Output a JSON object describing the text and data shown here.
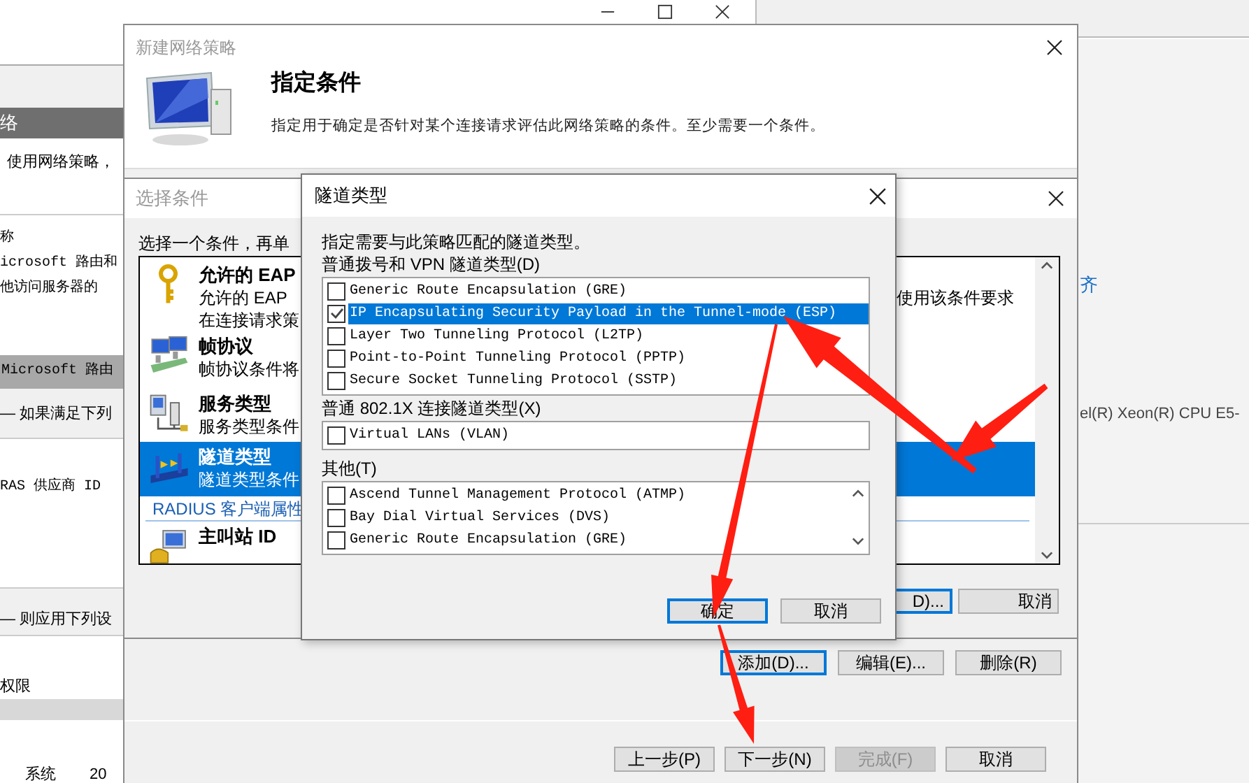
{
  "background_window": {
    "section_header": "络",
    "intro": "使用网络策略，",
    "detail_lines": [
      "称",
      "icrosoft 路由和",
      "他访问服务器的"
    ],
    "policy_bar": "Microsoft 路由",
    "conditions_heading": "— 如果满足下列",
    "conditions_column": "RAS 供应商 ID",
    "settings_heading": "— 则应用下列设",
    "settings_item": "权限",
    "bottom_row": [
      "系统",
      "20"
    ],
    "side_link": "齐",
    "side_info": "el(R) Xeon(R) CPU E5-"
  },
  "new_policy_dialog": {
    "title": "新建网络策略",
    "heading": "指定条件",
    "description": "指定用于确定是否针对某个连接请求评估此网络策略的条件。至少需要一个条件。",
    "condition_buttons": [
      {
        "label": "添加(D)...",
        "default": true
      },
      {
        "label": "编辑(E)...",
        "default": false
      },
      {
        "label": "删除(R)",
        "default": false
      }
    ],
    "nav_buttons": [
      {
        "label": "上一步(P)",
        "disabled": false
      },
      {
        "label": "下一步(N)",
        "disabled": false
      },
      {
        "label": "完成(F)",
        "disabled": true
      },
      {
        "label": "取消",
        "disabled": false
      }
    ]
  },
  "select_condition_dialog": {
    "title": "选择条件",
    "instruction": "选择一个条件，再单",
    "conditions": [
      {
        "kind": "condition",
        "title": "允许的 EAP",
        "description_lines": [
          "允许的 EAP",
          "在连接请求策"
        ],
        "description_tail": "使用该条件要求",
        "selected": false
      },
      {
        "kind": "condition",
        "title": "帧协议",
        "description_lines": [
          "帧协议条件将"
        ],
        "selected": false
      },
      {
        "kind": "condition",
        "title": "服务类型",
        "description_lines": [
          "服务类型条件"
        ],
        "selected": false
      },
      {
        "kind": "condition",
        "title": "隧道类型",
        "description_lines": [
          "隧道类型条件"
        ],
        "selected": true
      },
      {
        "kind": "group",
        "title": "RADIUS 客户端属性",
        "selected": false
      },
      {
        "kind": "condition",
        "title": "主叫站 ID",
        "selected": false
      }
    ],
    "buttons": [
      {
        "label": "D)...",
        "default": true
      },
      {
        "label": "取消",
        "default": false
      }
    ]
  },
  "tunnel_type_dialog": {
    "title": "隧道类型",
    "instruction": "指定需要与此策略匹配的隧道类型。",
    "groups": [
      {
        "label": "普通拨号和 VPN 隧道类型(D)",
        "scrollable": false,
        "items": [
          {
            "label": "Generic Route Encapsulation (GRE)",
            "checked": false,
            "selected": false
          },
          {
            "label": "IP Encapsulating Security Payload in the Tunnel-mode (ESP)",
            "checked": true,
            "selected": true
          },
          {
            "label": "Layer Two Tunneling Protocol (L2TP)",
            "checked": false,
            "selected": false
          },
          {
            "label": "Point-to-Point Tunneling Protocol (PPTP)",
            "checked": false,
            "selected": false
          },
          {
            "label": "Secure Socket Tunneling Protocol (SSTP)",
            "checked": false,
            "selected": false
          }
        ]
      },
      {
        "label": "普通 802.1X 连接隧道类型(X)",
        "scrollable": false,
        "items": [
          {
            "label": "Virtual LANs (VLAN)",
            "checked": false,
            "selected": false
          }
        ]
      },
      {
        "label": "其他(T)",
        "scrollable": true,
        "items": [
          {
            "label": "Ascend Tunnel Management Protocol (ATMP)",
            "checked": false,
            "selected": false
          },
          {
            "label": "Bay Dial Virtual Services (DVS)",
            "checked": false,
            "selected": false
          },
          {
            "label": "Generic Route Encapsulation (GRE)",
            "checked": false,
            "selected": false
          }
        ]
      }
    ],
    "buttons": [
      {
        "label": "确定",
        "default": true
      },
      {
        "label": "取消",
        "default": false
      }
    ]
  }
}
